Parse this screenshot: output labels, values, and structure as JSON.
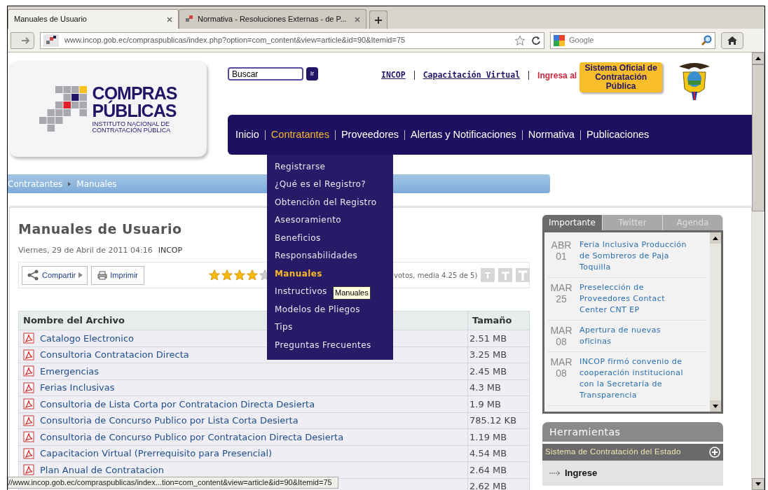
{
  "browser": {
    "tabs": [
      {
        "title": "Manuales de Usuario",
        "selected": true
      },
      {
        "title": "Normativa - Resoluciones Externas - de P...",
        "selected": false
      }
    ],
    "url": "www.incop.gob.ec/compraspublicas/index.php?option=com_content&view=article&id=90&Itemid=75",
    "search_placeholder": "Google"
  },
  "header": {
    "logo": {
      "line_1": "COMPRAS",
      "line_2": "PÚBLICAS",
      "line_3": "INSTITUTO NACIONAL DE",
      "line_4": "CONTRATACIÓN PÚBLICA"
    },
    "search": {
      "value": "Buscar",
      "button": "Ir"
    },
    "links": [
      "INCOP",
      "Capacitación Virtual"
    ],
    "promo_label": "Ingresa al",
    "promo_button": "Sistema Oficial de Contratación Pública"
  },
  "nav": [
    {
      "label": "Inicio",
      "selected": false
    },
    {
      "label": "Contratantes",
      "selected": true
    },
    {
      "label": "Proveedores",
      "selected": false
    },
    {
      "label": "Alertas y Notificaciones",
      "selected": false
    },
    {
      "label": "Normativa",
      "selected": false
    },
    {
      "label": "Publicaciones",
      "selected": false
    }
  ],
  "dropdown": {
    "items": [
      {
        "label": "Registrarse",
        "selected": false
      },
      {
        "label": "¿Qué es el Registro?",
        "selected": false
      },
      {
        "label": "Obtención del Registro",
        "selected": false
      },
      {
        "label": "Asesoramiento",
        "selected": false
      },
      {
        "label": "Beneficios",
        "selected": false
      },
      {
        "label": "Responsabilidades",
        "selected": false
      },
      {
        "label": "Manuales",
        "selected": true
      },
      {
        "label": "Instructivos",
        "selected": false
      },
      {
        "label": "Modelos de Pliegos",
        "selected": false
      },
      {
        "label": "Tips",
        "selected": false
      },
      {
        "label": "Preguntas Frecuentes",
        "selected": false
      }
    ],
    "tooltip": "Manuales"
  },
  "breadcrumb": [
    "Contratantes",
    "Manuales"
  ],
  "article": {
    "title": "Manuales de Usuario",
    "date": "Viernes, 29 de Abril de 2011 04:16",
    "author": "INCOP",
    "share": "Compartir",
    "print": "Imprimir",
    "stars": 4,
    "rating": "votos, media 4.25 de 5)",
    "table": {
      "columns": [
        "Nombre del Archivo",
        "Tamaño"
      ],
      "rows": [
        {
          "name": "Catalogo Electronico",
          "size": "2.51 MB"
        },
        {
          "name": "Consultoria Contratacion Directa",
          "size": "3.25 MB"
        },
        {
          "name": "Emergencias",
          "size": "2.45 MB"
        },
        {
          "name": "Ferias Inclusivas",
          "size": "4.3 MB"
        },
        {
          "name": "Consultoria de Lista Corta por Contratacion Directa Desierta",
          "size": "1.9 MB"
        },
        {
          "name": "Consultoria de Concurso Publico por Lista Corta Desierta",
          "size": "785.12 KB"
        },
        {
          "name": "Consultoria de Concurso Publico por Contratacion Directa Desierta",
          "size": "1.19 MB"
        },
        {
          "name": "Capacitacion Virtual (Prerrequisito para Presencial)",
          "size": "4.54 MB"
        },
        {
          "name": "Plan Anual de Contratacion",
          "size": "2.64 MB"
        },
        {
          "size": "2.62 MB"
        }
      ]
    }
  },
  "sidebar": {
    "tabs": [
      {
        "label": "Importante",
        "selected": true
      },
      {
        "label": "Twitter",
        "selected": false
      },
      {
        "label": "Agenda",
        "selected": false
      }
    ],
    "news": [
      {
        "month": "ABR",
        "day": "01",
        "title": "Feria Inclusiva Producción de Sombreros de Paja Toquilla"
      },
      {
        "month": "MAR",
        "day": "25",
        "title": "Preselección de Proveedores Contact Center CNT EP"
      },
      {
        "month": "MAR",
        "day": "08",
        "title": "Apertura de nuevas oficinas"
      },
      {
        "month": "MAR",
        "day": "08",
        "title": "INCOP firmó convenio de cooperación institucional con la Secretaría de Transparencia"
      }
    ],
    "tools": {
      "title": "Herramientas",
      "section": "Sistema de Contratación del Estado",
      "link": "Ingrese"
    }
  },
  "status_bar": "//www.incop.gob.ec/compraspublicas/index...tion=com_content&view=article&id=90&Itemid=75"
}
